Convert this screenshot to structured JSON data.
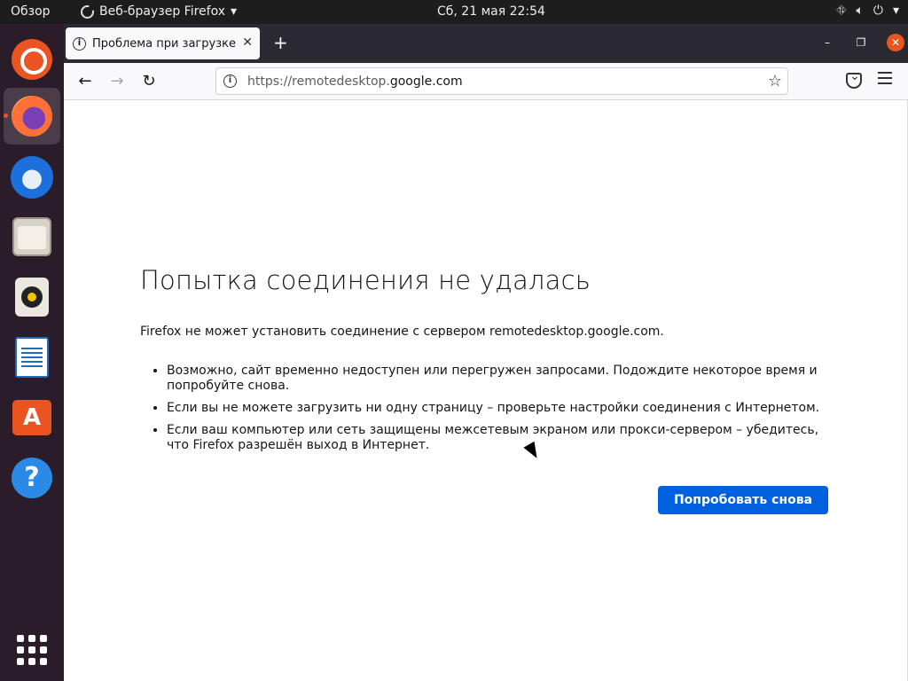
{
  "topbar": {
    "activities": "Обзор",
    "app_name": "Веб-браузер Firefox",
    "clock": "Сб, 21 мая  22:54"
  },
  "dock": {
    "items": [
      "ubuntu-icon",
      "firefox-icon",
      "thunderbird-icon",
      "files-icon",
      "rhythmbox-icon",
      "writer-icon",
      "software-icon",
      "help-icon",
      "app-grid-icon"
    ]
  },
  "browser": {
    "tab_title": "Проблема при загрузке страницы",
    "url_prefix": "https://remotedesktop.",
    "url_domain": "google.com"
  },
  "error": {
    "title": "Попытка соединения не удалась",
    "description": "Firefox не может установить соединение с сервером remotedesktop.google.com.",
    "items": [
      "Возможно, сайт временно недоступен или перегружен запросами. Подождите некоторое время и попробуйте снова.",
      "Если вы не можете загрузить ни одну страницу – проверьте настройки соединения с Интернетом.",
      "Если ваш компьютер или сеть защищены межсетевым экраном или прокси-сервером – убедитесь, что Firefox разрешён выход в Интернет."
    ],
    "retry_label": "Попробовать снова"
  }
}
